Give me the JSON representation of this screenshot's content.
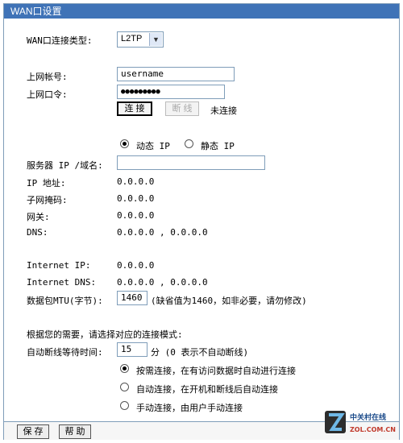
{
  "title": "WAN口设置",
  "wan_type": {
    "label": "WAN口连接类型:",
    "value": "L2TP"
  },
  "account": {
    "user_label": "上网帐号:",
    "user_value": "username",
    "pass_label": "上网口令:",
    "pass_value": "●●●●●●●●●"
  },
  "connect": {
    "connect_label": "连 接",
    "disconnect_label": "断 线",
    "status": "未连接"
  },
  "ipmode": {
    "dynamic": "动态 IP",
    "static": "静态 IP"
  },
  "server": {
    "label": "服务器 IP /域名:",
    "value": ""
  },
  "info": {
    "ip_label": "IP 地址:",
    "ip_value": "0.0.0.0",
    "mask_label": "子网掩码:",
    "mask_value": "0.0.0.0",
    "gw_label": "网关:",
    "gw_value": "0.0.0.0",
    "dns_label": "DNS:",
    "dns_value": "0.0.0.0 , 0.0.0.0",
    "inet_ip_label": "Internet IP:",
    "inet_ip_value": "0.0.0.0",
    "inet_dns_label": "Internet DNS:",
    "inet_dns_value": "0.0.0.0 , 0.0.0.0"
  },
  "mtu": {
    "label": "数据包MTU(字节):",
    "value": "1460",
    "hint": "(缺省值为1460，如非必要，请勿修改)"
  },
  "mode": {
    "heading": "根据您的需要，请选择对应的连接模式:",
    "idle_label": "自动断线等待时间:",
    "idle_value": "15",
    "idle_hint": "分 (0 表示不自动断线)",
    "opt1": "按需连接，在有访问数据时自动进行连接",
    "opt2": "自动连接，在开机和断线后自动连接",
    "opt3": "手动连接，由用户手动连接"
  },
  "footer": {
    "save": "保 存",
    "help": "帮 助"
  },
  "watermark": {
    "line1": "中关村在线",
    "line2": "ZOL.COM.CN"
  },
  "colors": {
    "accent": "#3f73b7"
  }
}
